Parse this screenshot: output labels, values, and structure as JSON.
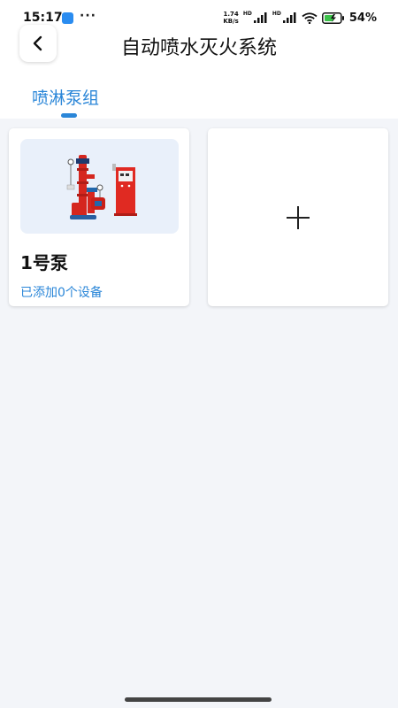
{
  "status_bar": {
    "time": "15:17",
    "dots": "···",
    "net_speed_value": "1.74",
    "net_speed_unit": "KB/s",
    "hd_label": "HD",
    "battery_percent": "54%"
  },
  "header": {
    "title": "自动喷水灭火系统"
  },
  "tabs": [
    {
      "label": "喷淋泵组",
      "selected": true
    }
  ],
  "cards": [
    {
      "name": "1号泵",
      "device_count_text": "已添加0个设备",
      "image": "pump-assembly-image"
    }
  ],
  "add_card": {
    "icon": "plus-icon"
  },
  "colors": {
    "accent": "#2a86d8",
    "page_background": "#f3f5f9",
    "pump_red": "#d5261e",
    "image_background": "#e9f0fa"
  }
}
